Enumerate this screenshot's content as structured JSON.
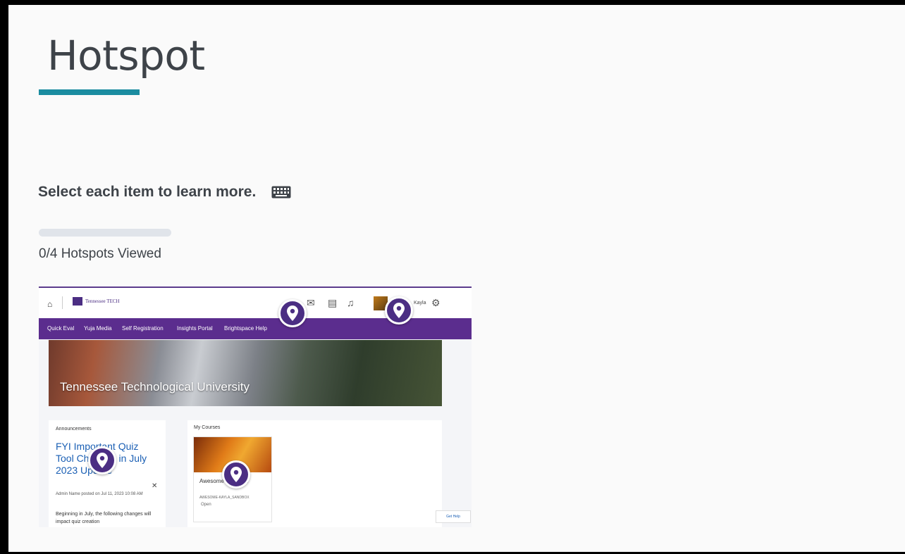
{
  "page": {
    "title": "Hotspot",
    "accent_color": "#1b8ca0",
    "instructions": "Select each item to learn more.",
    "keyboard_icon": "keyboard-icon"
  },
  "progress": {
    "viewed": 0,
    "total": 4,
    "label": "0/4 Hotspots Viewed",
    "fraction": 0
  },
  "screenshot": {
    "header": {
      "logo_text": "Tennessee TECH",
      "user_name": "Kayla"
    },
    "nav_items": [
      "Quick Eval",
      "Yuja Media",
      "Self Registration",
      "Insights Portal",
      "Brightspace Help"
    ],
    "nav_color": "#5b2d8e",
    "banner_title": "Tennessee Technological University",
    "announcements": {
      "header": "Announcements",
      "link": "FYI Important Quiz Tool Changes in July 2023 Update",
      "meta": "Admin Name posted on Jul 11, 2023 10:08 AM",
      "body": "Beginning in July, the following changes will impact quiz creation"
    },
    "courses": {
      "header": "My Courses",
      "course_name": "Awesome Sandbox",
      "course_code": "AWESOME-KAYLA_SANDBOX",
      "course_status": "Open"
    },
    "help_label": "Get Help"
  },
  "hotspots": [
    {
      "label": "Hotspot 1"
    },
    {
      "label": "Hotspot 2"
    },
    {
      "label": "Hotspot 3"
    },
    {
      "label": "Hotspot 4"
    }
  ],
  "hotspot_color": "#4b2e83"
}
